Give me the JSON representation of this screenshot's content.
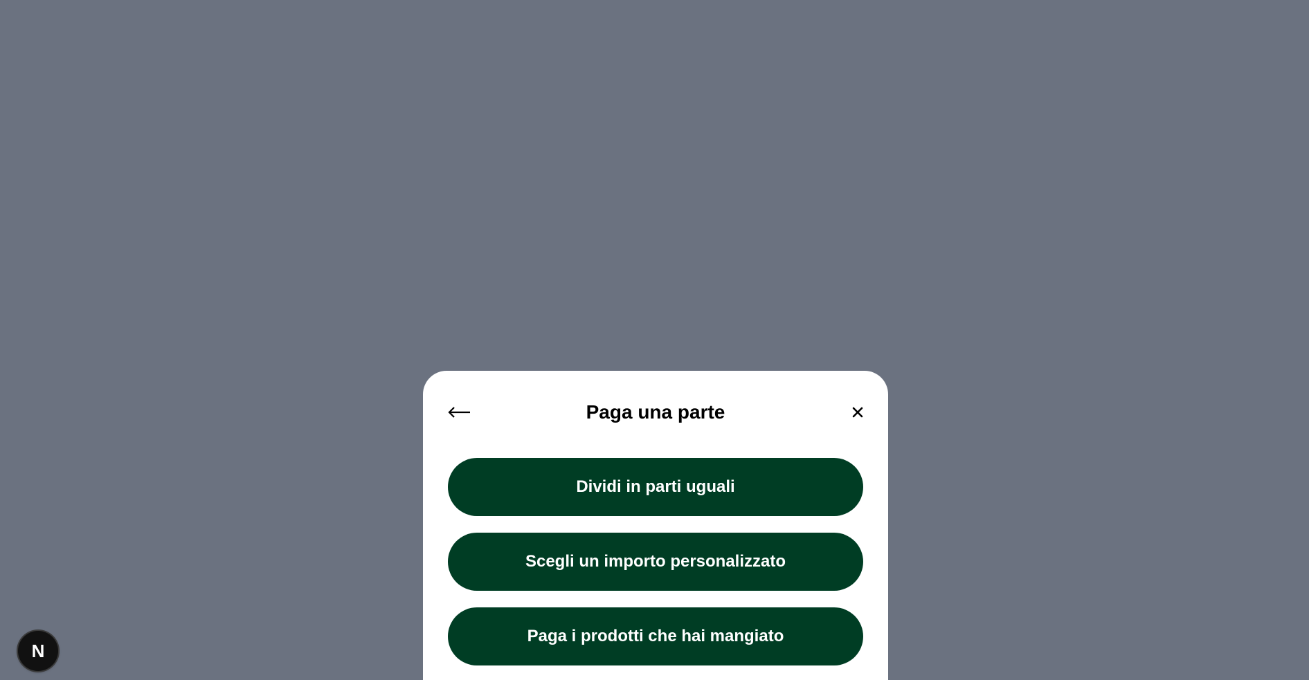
{
  "modal": {
    "title": "Paga una parte",
    "back_icon": "arrow-left-icon",
    "close_icon": "close-icon",
    "options": [
      {
        "label": "Dividi in parti uguali"
      },
      {
        "label": "Scegli un importo personalizzato"
      },
      {
        "label": "Paga i prodotti che hai mangiato"
      }
    ]
  },
  "dev_badge": {
    "letter": "N",
    "icon": "nextjs-logo-icon"
  },
  "colors": {
    "backdrop": "#6b7280",
    "sheet": "#ffffff",
    "button": "#003d24",
    "button_text": "#ffffff"
  }
}
